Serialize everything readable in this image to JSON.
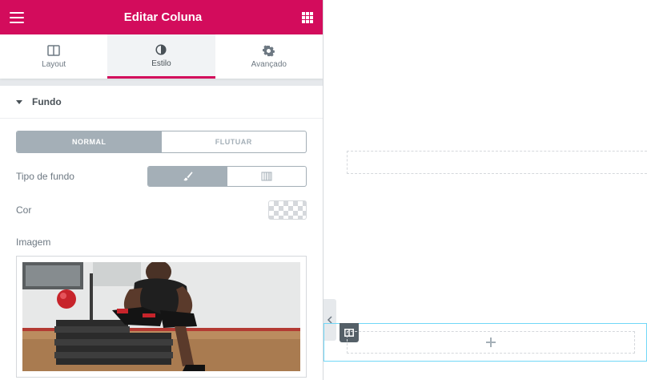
{
  "header": {
    "title": "Editar Coluna",
    "menu_icon": "hamburger-icon",
    "apps_icon": "grid-icon"
  },
  "tabs": [
    {
      "label": "Layout",
      "icon": "columns-icon",
      "active": false
    },
    {
      "label": "Estilo",
      "icon": "contrast-icon",
      "active": true
    },
    {
      "label": "Avançado",
      "icon": "gear-icon",
      "active": false
    }
  ],
  "section": {
    "title": "Fundo"
  },
  "state_switcher": {
    "normal": "NORMAL",
    "hover": "FLUTUAR",
    "selected": "NORMAL"
  },
  "background_type": {
    "label": "Tipo de fundo",
    "options": [
      "brush-icon",
      "gradient-icon"
    ],
    "selected": "brush-icon"
  },
  "color": {
    "label": "Cor",
    "value": "transparent"
  },
  "image": {
    "label": "Imagem"
  },
  "colors": {
    "accent": "#d30c5c",
    "control": "#a4afb7",
    "text": "#6d7882",
    "section_border": "#71d7f7"
  }
}
